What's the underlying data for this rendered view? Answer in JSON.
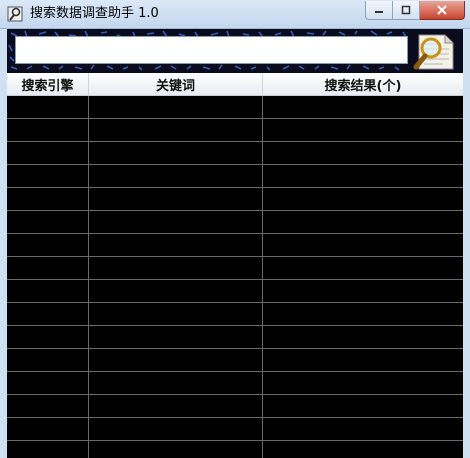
{
  "window": {
    "title": "搜索数据调查助手 1.0",
    "icon": "search-tool-icon",
    "controls": [
      "minimize-icon",
      "maximize-icon",
      "close-icon"
    ]
  },
  "search": {
    "value": "",
    "button_icon": "magnifier-document-icon"
  },
  "grid": {
    "columns": [
      "搜索引擎",
      "关键词",
      "搜索结果(个)"
    ],
    "rows": [
      [
        "",
        "",
        ""
      ],
      [
        "",
        "",
        ""
      ],
      [
        "",
        "",
        ""
      ],
      [
        "",
        "",
        ""
      ],
      [
        "",
        "",
        ""
      ],
      [
        "",
        "",
        ""
      ],
      [
        "",
        "",
        ""
      ],
      [
        "",
        "",
        ""
      ],
      [
        "",
        "",
        ""
      ],
      [
        "",
        "",
        ""
      ],
      [
        "",
        "",
        ""
      ],
      [
        "",
        "",
        ""
      ],
      [
        "",
        "",
        ""
      ],
      [
        "",
        "",
        ""
      ],
      [
        "",
        "",
        ""
      ],
      [
        "",
        "",
        ""
      ]
    ]
  },
  "colors": {
    "grid_background": "#000000",
    "grid_line": "#6a6a6a",
    "banner_background": "#0b0b1e",
    "banner_pattern": "#3a6fd8",
    "close_button": "#c8442f"
  }
}
